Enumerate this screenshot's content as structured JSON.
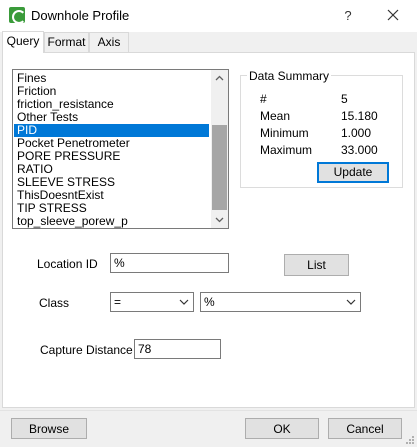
{
  "window": {
    "title": "Downhole Profile",
    "help": "?",
    "close": "✕"
  },
  "tabs": [
    {
      "label": "Query",
      "active": true
    },
    {
      "label": "Format",
      "active": false
    },
    {
      "label": "Axis",
      "active": false
    }
  ],
  "list": {
    "items": [
      "Fines",
      "Friction",
      "friction_resistance",
      "Other Tests",
      "PID",
      "Pocket Penetrometer",
      "PORE PRESSURE",
      "RATIO",
      "SLEEVE STRESS",
      "ThisDoesntExist",
      "TIP STRESS",
      "top_sleeve_porew_p"
    ],
    "selected_index": 4
  },
  "data_summary": {
    "title": "Data Summary",
    "rows": [
      {
        "label": "#",
        "value": "5"
      },
      {
        "label": "Mean",
        "value": "15.180"
      },
      {
        "label": "Minimum",
        "value": "1.000"
      },
      {
        "label": "Maximum",
        "value": "33.000"
      }
    ],
    "update_label": "Update"
  },
  "form": {
    "location_label": "Location ID",
    "location_value": "%",
    "list_button": "List",
    "class_label": "Class",
    "class_operator": "=",
    "class_value": "%",
    "capture_label": "Capture Distance",
    "capture_value": "78"
  },
  "footer": {
    "browse": "Browse",
    "ok": "OK",
    "cancel": "Cancel"
  },
  "colors": {
    "selection": "#0078d7",
    "accent": "#0078d7",
    "icon_green": "#3a9b3a"
  }
}
